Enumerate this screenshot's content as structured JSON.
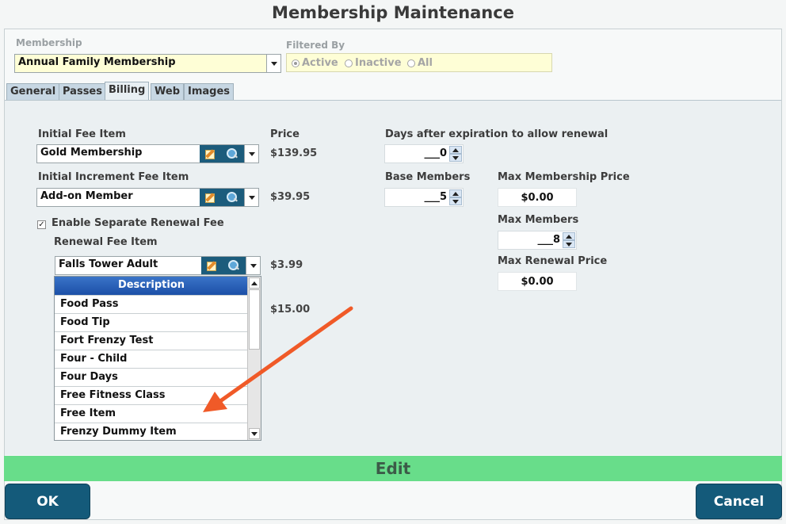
{
  "window": {
    "title": "Membership Maintenance"
  },
  "membership": {
    "label": "Membership",
    "value": "Annual Family Membership"
  },
  "filter": {
    "label": "Filtered By",
    "options": [
      "Active",
      "Inactive",
      "All"
    ],
    "selected": "Active"
  },
  "tabs": [
    {
      "label": "General"
    },
    {
      "label": "Passes"
    },
    {
      "label": "Billing",
      "active": true
    },
    {
      "label": "Web"
    },
    {
      "label": "Images"
    }
  ],
  "billing": {
    "initial_fee_label": "Initial Fee Item",
    "initial_fee_value": "Gold Membership",
    "price_label": "Price",
    "initial_fee_price": "$139.95",
    "increment_fee_label": "Initial Increment Fee Item",
    "increment_fee_value": "Add-on Member",
    "increment_fee_price": "$39.95",
    "enable_renewal_label": "Enable Separate Renewal Fee",
    "enable_renewal_checked": true,
    "renewal_fee_label": "Renewal Fee Item",
    "renewal_fee_value": "Falls Tower Adult",
    "renewal_fee_price": "$3.99",
    "hidden_price": "$15.00",
    "days_label": "Days after expiration to allow renewal",
    "days_value": "___0",
    "base_members_label": "Base Members",
    "base_members_value": "___5",
    "max_price_label": "Max Membership Price",
    "max_price_value": "$0.00",
    "max_members_label": "Max Members",
    "max_members_value": "___8",
    "max_renewal_label": "Max Renewal Price",
    "max_renewal_value": "$0.00"
  },
  "dropdown": {
    "header": "Description",
    "items": [
      "Food Pass",
      "Food Tip",
      "Fort Frenzy Test",
      "Four - Child",
      "Four Days",
      "Free Fitness Class",
      "Free Item",
      "Frenzy Dummy Item"
    ]
  },
  "footer": {
    "edit_label": "Edit",
    "ok_label": "OK",
    "cancel_label": "Cancel"
  },
  "colors": {
    "accent": "#145a7a",
    "edit_bar": "#68dd8a",
    "arrow": "#f05a28",
    "dropdown_header": "#2a62b8"
  }
}
